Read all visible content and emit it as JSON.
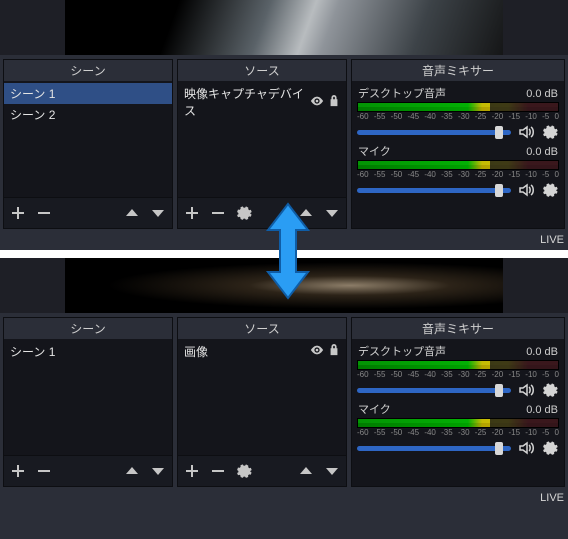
{
  "sections": [
    "top",
    "bottom"
  ],
  "top": {
    "panels": {
      "scenes": {
        "title": "シーン",
        "items": [
          "シーン 1",
          "シーン 2"
        ],
        "selected_index": 0
      },
      "sources": {
        "title": "ソース",
        "items": [
          {
            "label": "映像キャプチャデバイス",
            "visible": true,
            "locked": true
          }
        ],
        "show_gear": true
      },
      "mixer": {
        "title": "音声ミキサー",
        "channels": [
          {
            "name": "デスクトップ音声",
            "db": "0.0 dB"
          },
          {
            "name": "マイク",
            "db": "0.0 dB"
          }
        ],
        "ticks": [
          "-60",
          "-55",
          "-50",
          "-45",
          "-40",
          "-35",
          "-30",
          "-25",
          "-20",
          "-15",
          "-10",
          "-5",
          "0"
        ]
      }
    },
    "status": "LIVE"
  },
  "bottom": {
    "panels": {
      "scenes": {
        "title": "シーン",
        "items": [
          "シーン 1"
        ],
        "selected_index": null
      },
      "sources": {
        "title": "ソース",
        "items": [
          {
            "label": "画像",
            "visible": true,
            "locked": true
          }
        ],
        "show_gear": true
      },
      "mixer": {
        "title": "音声ミキサー",
        "channels": [
          {
            "name": "デスクトップ音声",
            "db": "0.0 dB"
          },
          {
            "name": "マイク",
            "db": "0.0 dB"
          }
        ],
        "ticks": [
          "-60",
          "-55",
          "-50",
          "-45",
          "-40",
          "-35",
          "-30",
          "-25",
          "-20",
          "-15",
          "-10",
          "-5",
          "0"
        ]
      }
    },
    "status": "LIVE"
  },
  "icons": {
    "plus": "+",
    "minus": "−",
    "up": "˄",
    "down": "˅",
    "gear": "⚙",
    "eye": "👁",
    "lock": "🔒",
    "speaker": "🔊"
  }
}
